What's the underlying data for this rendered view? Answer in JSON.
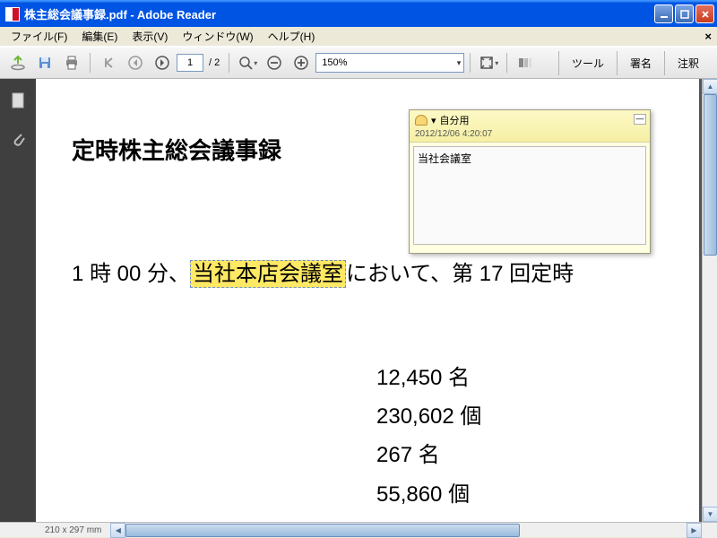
{
  "window": {
    "title": "株主総会議事録.pdf - Adobe Reader"
  },
  "menu": {
    "file": "ファイル(F)",
    "edit": "編集(E)",
    "view": "表示(V)",
    "window": "ウィンドウ(W)",
    "help": "ヘルプ(H)"
  },
  "toolbar": {
    "page_current": "1",
    "page_total": "/ 2",
    "zoom": "150%"
  },
  "right_tools": {
    "tools": "ツール",
    "sign": "署名",
    "comment": "注釈"
  },
  "document": {
    "title": "定時株主総会議事録",
    "line_prefix": "1 時 00 分、",
    "line_highlight": "当社本店会議室",
    "line_suffix": "において、第 17 回定時",
    "stat1": "12,450 名",
    "stat2": "230,602 個",
    "stat3": "267 名",
    "stat4": "55,860 個"
  },
  "note": {
    "author_label": "自分用",
    "options_glyph": "▾",
    "timestamp": "2012/12/06 4:20:07",
    "content": "当社会議室"
  },
  "status": {
    "page_size": "210 x 297 mm"
  }
}
